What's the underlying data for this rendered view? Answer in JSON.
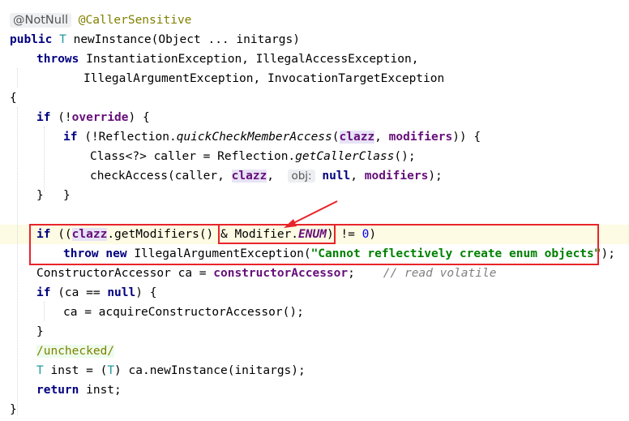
{
  "editor": {
    "annotations": {
      "notnull": "@NotNull",
      "caller_sensitive": "@CallerSensitive"
    },
    "tokens": {
      "kw_public": "public",
      "type_T": "T",
      "method_decl": "newInstance(Object ... initargs)",
      "kw_throws": "throws",
      "throws_list_1": "InstantiationException, IllegalAccessException,",
      "throws_list_2": "IllegalArgumentException, InvocationTargetException",
      "brace_open": "{",
      "brace_close": "}",
      "kw_if": "if",
      "paren_open": "(",
      "paren_close": ")",
      "not_override_pre": "(!",
      "field_override": "override",
      "not_override_post": ") {",
      "reflection_pre": "(!Reflection.",
      "quick_check": "quickCheckMemberAccess",
      "field_clazz": "clazz",
      "comma_sp": ", ",
      "field_modifiers": "modifiers",
      "close_block": ")) {",
      "class_caller": "Class<?> caller = Reflection.",
      "get_caller_class": "getCallerClass",
      "call_end": "();",
      "check_access": "checkAccess(caller, ",
      "param_hint": "obj:",
      "kw_null": "null",
      "call_end2": ");",
      "getmods_pre": "((",
      "getmods": ".getModifiers() & ",
      "modifier_enum": "Modifier.",
      "enum_const": "ENUM",
      "neq": ") != ",
      "zero": "0",
      "close_paren": ")",
      "kw_throw": "throw",
      "kw_new": "new",
      "iae": "IllegalArgumentException(",
      "error_string": "\"Cannot reflectively create enum objects\"",
      "semicolon_end": ");",
      "ca_decl": "ConstructorAccessor ca = ",
      "field_ctor_accessor": "constructorAccessor",
      "semicolon": ";",
      "comment": "// read volatile",
      "ca_eq_null_pre": "(ca == ",
      "ca_eq_null_post": ") {",
      "acquire": "ca = acquireConstructorAccessor();",
      "noinspection": "/unchecked/",
      "inst_mid": " inst = (",
      "inst_end": ") ca.newInstance(initargs);",
      "kw_return": "return",
      "return_rest": " inst;"
    }
  },
  "colors": {
    "highlight_box": "#e8242b",
    "keyword": "#000080",
    "field": "#660e7a",
    "string": "#008000"
  }
}
